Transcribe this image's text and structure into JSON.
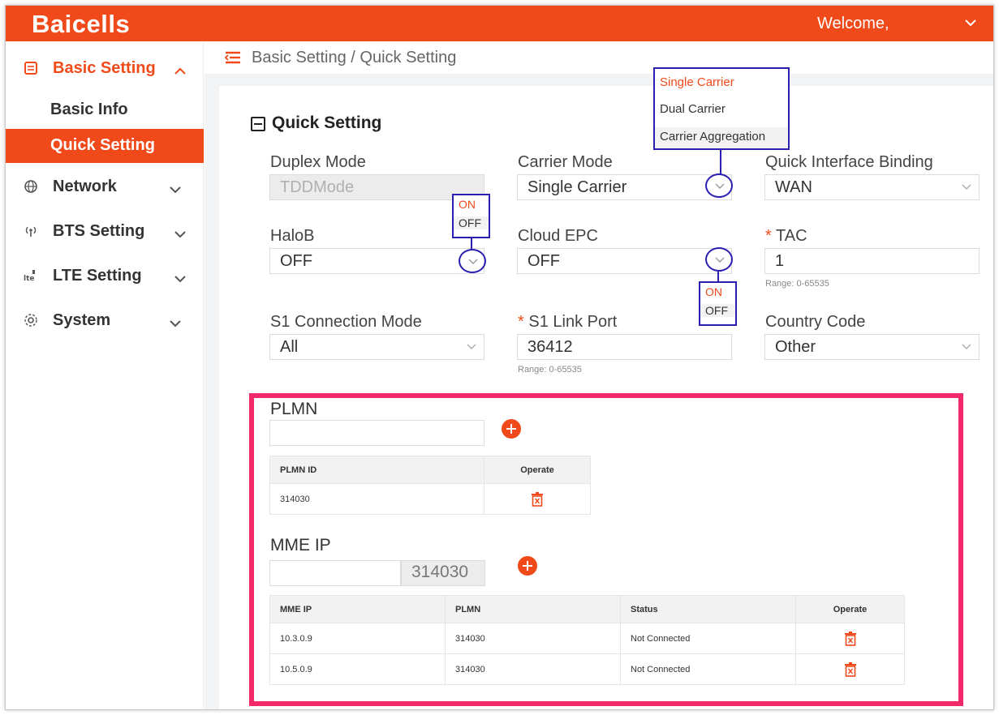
{
  "header": {
    "logo": "Baicells",
    "welcome": "Welcome,"
  },
  "sidebar": {
    "basic_setting": "Basic Setting",
    "basic_info": "Basic Info",
    "quick_setting": "Quick Setting",
    "network": "Network",
    "bts_setting": "BTS Setting",
    "lte_setting": "LTE Setting",
    "system": "System"
  },
  "breadcrumb": "Basic Setting / Quick Setting",
  "section_title": "Quick Setting",
  "fields": {
    "duplex_mode": {
      "label": "Duplex Mode",
      "value": "TDDMode"
    },
    "carrier_mode": {
      "label": "Carrier Mode",
      "value": "Single Carrier"
    },
    "quick_interface_binding": {
      "label": "Quick Interface Binding",
      "value": "WAN"
    },
    "halob": {
      "label": "HaloB",
      "value": "OFF"
    },
    "cloud_epc": {
      "label": "Cloud EPC",
      "value": "OFF"
    },
    "tac": {
      "required": "*",
      "label": "TAC",
      "value": "1",
      "hint": "Range: 0-65535"
    },
    "s1_connection_mode": {
      "label": "S1 Connection Mode",
      "value": "All"
    },
    "s1_link_port": {
      "required": "*",
      "label": "S1 Link Port",
      "value": "36412",
      "hint": "Range: 0-65535"
    },
    "country_code": {
      "label": "Country Code",
      "value": "Other"
    }
  },
  "annotations": {
    "carrier_options": [
      "Single Carrier",
      "Dual Carrier",
      "Carrier Aggregation"
    ],
    "halob_options": [
      "ON",
      "OFF"
    ],
    "cloud_epc_options": [
      "ON",
      "OFF"
    ]
  },
  "plmn": {
    "label": "PLMN",
    "input_value": "",
    "columns": [
      "PLMN ID",
      "Operate"
    ],
    "rows": [
      {
        "plmn_id": "314030"
      }
    ]
  },
  "mme": {
    "label": "MME IP",
    "input_value": "",
    "plmn_select": "314030",
    "columns": [
      "MME IP",
      "PLMN",
      "Status",
      "Operate"
    ],
    "rows": [
      {
        "mme_ip": "10.3.0.9",
        "plmn": "314030",
        "status": "Not Connected"
      },
      {
        "mme_ip": "10.5.0.9",
        "plmn": "314030",
        "status": "Not Connected"
      }
    ]
  },
  "colors": {
    "brand": "#f04a1a",
    "annotation_blue": "#2a1fb0",
    "highlight_pink": "#f22a6a"
  }
}
